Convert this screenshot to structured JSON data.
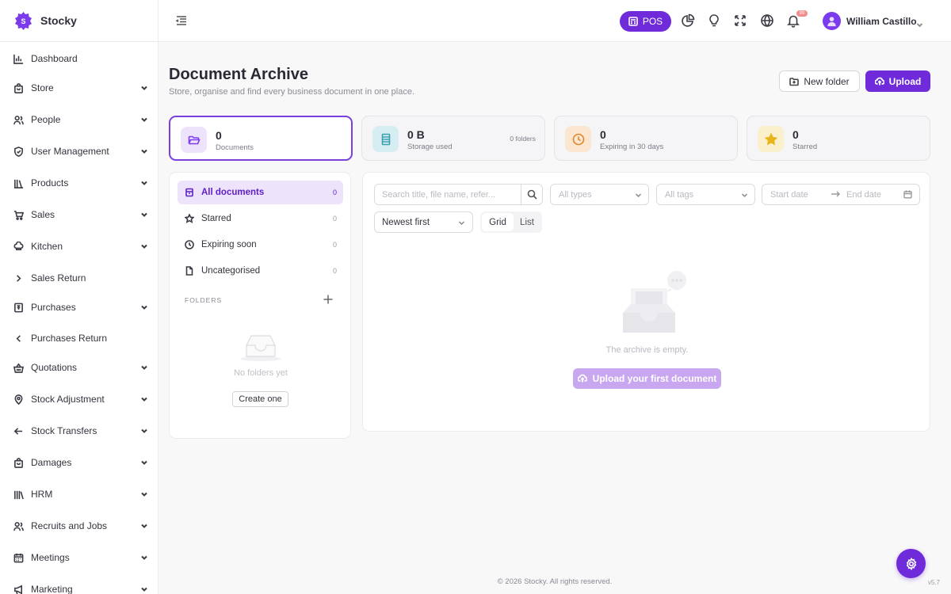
{
  "brand": {
    "name": "Stocky",
    "logo_letter": "S"
  },
  "sidebar": {
    "items": [
      {
        "label": "Dashboard",
        "icon": "bar-chart-icon",
        "chevron": "none"
      },
      {
        "label": "Store",
        "icon": "store-bag-icon",
        "chevron": "down"
      },
      {
        "label": "People",
        "icon": "people-icon",
        "chevron": "down"
      },
      {
        "label": "User Management",
        "icon": "shield-icon",
        "chevron": "down"
      },
      {
        "label": "Products",
        "icon": "books-icon",
        "chevron": "down"
      },
      {
        "label": "Sales",
        "icon": "cart-icon",
        "chevron": "down"
      },
      {
        "label": "Kitchen",
        "icon": "chef-hat-icon",
        "chevron": "down"
      },
      {
        "label": "Sales Return",
        "icon": "chevron-right-icon",
        "chevron": "none"
      },
      {
        "label": "Purchases",
        "icon": "receipt-icon",
        "chevron": "down"
      },
      {
        "label": "Purchases Return",
        "icon": "chevron-left-icon",
        "chevron": "none"
      },
      {
        "label": "Quotations",
        "icon": "basket-icon",
        "chevron": "down"
      },
      {
        "label": "Stock Adjustment",
        "icon": "location-pin-icon",
        "chevron": "down"
      },
      {
        "label": "Stock Transfers",
        "icon": "arrow-left-icon",
        "chevron": "down"
      },
      {
        "label": "Damages",
        "icon": "bag-icon",
        "chevron": "down"
      },
      {
        "label": "HRM",
        "icon": "library-icon",
        "chevron": "down"
      },
      {
        "label": "Recruits and Jobs",
        "icon": "users-icon",
        "chevron": "down"
      },
      {
        "label": "Meetings",
        "icon": "calendar-icon",
        "chevron": "down"
      },
      {
        "label": "Marketing",
        "icon": "megaphone-icon",
        "chevron": "down"
      }
    ]
  },
  "topbar": {
    "pos_label": "POS",
    "notification_badge": "99",
    "user_name": "William Castillo"
  },
  "page": {
    "title": "Document Archive",
    "subtitle": "Store, organise and find every business document in one place.",
    "new_folder_label": "New folder",
    "upload_label": "Upload"
  },
  "stats": [
    {
      "value": "0",
      "label": "Documents",
      "side": "",
      "icon": "folder-open-icon",
      "color": "#7c3aed",
      "bg": "#ede4fc"
    },
    {
      "value": "0 B",
      "label": "Storage used",
      "side": "0 folders",
      "icon": "server-icon",
      "color": "#3aa0b0",
      "bg": "#d6eef2"
    },
    {
      "value": "0",
      "label": "Expiring in 30 days",
      "side": "",
      "icon": "clock-icon",
      "color": "#e0872a",
      "bg": "#fbe6d2"
    },
    {
      "value": "0",
      "label": "Starred",
      "side": "",
      "icon": "star-icon",
      "color": "#e8b419",
      "bg": "#fbf0cc"
    }
  ],
  "filters": [
    {
      "label": "All documents",
      "count": "0",
      "icon": "archive-icon"
    },
    {
      "label": "Starred",
      "count": "0",
      "icon": "star-outline-icon"
    },
    {
      "label": "Expiring soon",
      "count": "0",
      "icon": "clock-icon"
    },
    {
      "label": "Uncategorised",
      "count": "0",
      "icon": "file-icon"
    }
  ],
  "folders": {
    "heading": "FOLDERS",
    "empty_text": "No folders yet",
    "create_label": "Create one"
  },
  "toolbar": {
    "search_placeholder": "Search title, file name, refer...",
    "types_placeholder": "All types",
    "tags_placeholder": "All tags",
    "start_date_placeholder": "Start date",
    "end_date_placeholder": "End date",
    "sort_value": "Newest first",
    "view_grid": "Grid",
    "view_list": "List"
  },
  "empty_state": {
    "text": "The archive is empty.",
    "button_label": "Upload your first document"
  },
  "footer": {
    "copyright": "© 2026 Stocky. All rights reserved.",
    "version": "v5.7"
  },
  "colors": {
    "accent": "#6f2bd9",
    "accent_light": "#ede4fc"
  }
}
